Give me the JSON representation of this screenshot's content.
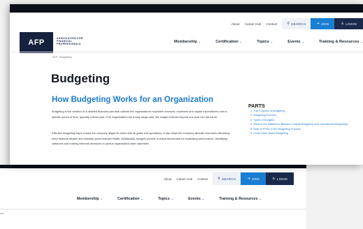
{
  "front": {
    "util_links": [
      "About",
      "Career Hub",
      "Contact"
    ],
    "search_label": "SEARCH",
    "join_label": "JOIN",
    "login_label": "LOGIN",
    "logo_mark": "AFP",
    "logo_text": "ASSOCIATION FOR FINANCIAL PROFESSIONALS",
    "nav": [
      "Membership",
      "Certification",
      "Topics",
      "Events",
      "Training & Resources"
    ],
    "breadcrumb": "AFP  /  Budgeting",
    "page_title": "Budgeting",
    "section_title": "How Budgeting Works for an Organization",
    "paragraph1": "Budgeting is the creation of a detailed financial plan that outlines the organization's expected revenues, expenses and capital expenditures over a specific period of time, typically a fiscal year. If an organization has a long-range plan, the budget extends beyond one year into the future.",
    "paragraph2": "Effective budgeting helps ensure the company aligns its vision with its goals and operations. It also helps the company allocate resources effectively, meet financial targets and maintain good financial health. Additionally, budgets provide a critical benchmark for evaluating performance, identifying variances and making informed decisions to pursue organization-wide objectives.",
    "parts_title": "PARTS",
    "parts": [
      "1. The Purpose of Budgeting",
      "2. Budgeting Process",
      "3. Types of Budgets",
      "4. What is the Difference Between Capital Budgeting and Operational Budgeting?",
      "5. Role of FP&A in the Budgeting Process",
      "6. Learn More About Budgeting"
    ]
  },
  "back": {
    "util_links": [
      "About",
      "Career Hub",
      "Contact"
    ],
    "search_label": "SEARCH",
    "join_label": "JOIN",
    "login_label": "LOGIN",
    "nav": [
      "Membership",
      "Certification",
      "Topics",
      "Events",
      "Training & Resources"
    ],
    "breadcrumb": "ent"
  },
  "colors": {
    "accent_blue": "#1b7bd0",
    "navy": "#1b2a4c",
    "top_bar": "#0d1018"
  }
}
